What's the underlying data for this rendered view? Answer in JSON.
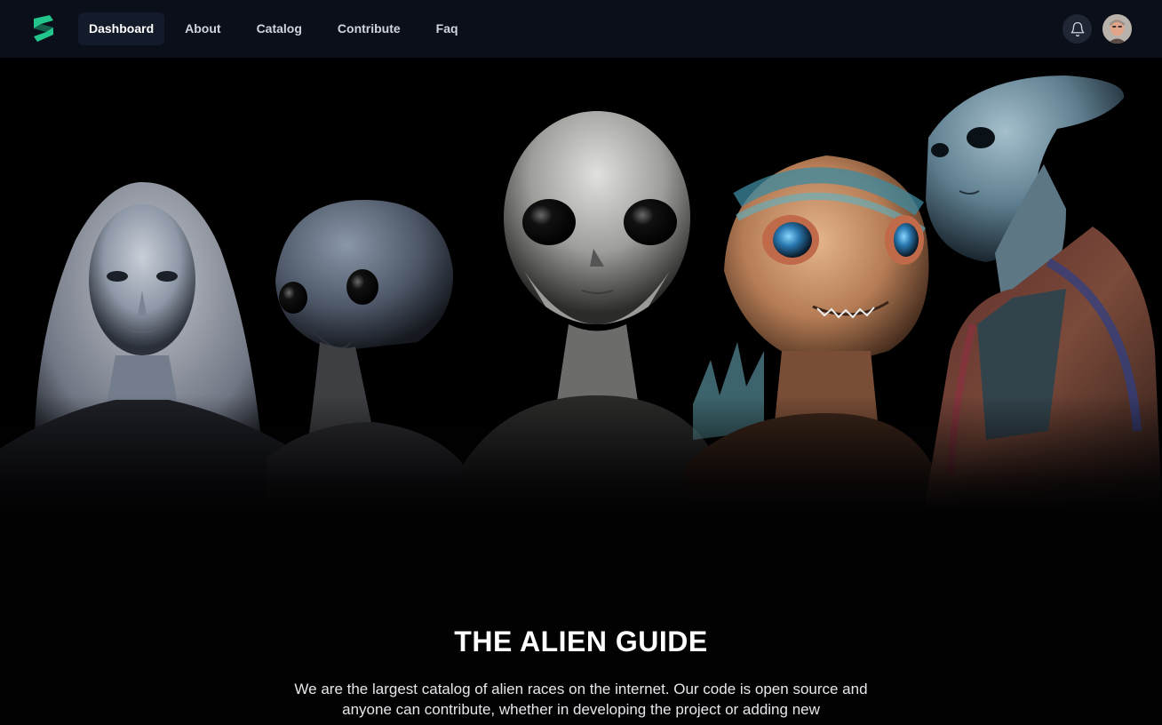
{
  "nav": {
    "items": [
      {
        "label": "Dashboard"
      },
      {
        "label": "About"
      },
      {
        "label": "Catalog"
      },
      {
        "label": "Contribute"
      },
      {
        "label": "Faq"
      }
    ],
    "active": "Dashboard",
    "accent": "#22c58b"
  },
  "hero": {
    "image": "five-alien-portraits"
  },
  "content": {
    "title": "THE ALIEN GUIDE",
    "description": "We are the largest catalog of alien races on the internet. Our code is open source and anyone can contribute, whether in developing the project or adding new"
  },
  "colors": {
    "background": "#020203",
    "navbar": "#0a0f1a",
    "active_tab": "#131a2a"
  }
}
